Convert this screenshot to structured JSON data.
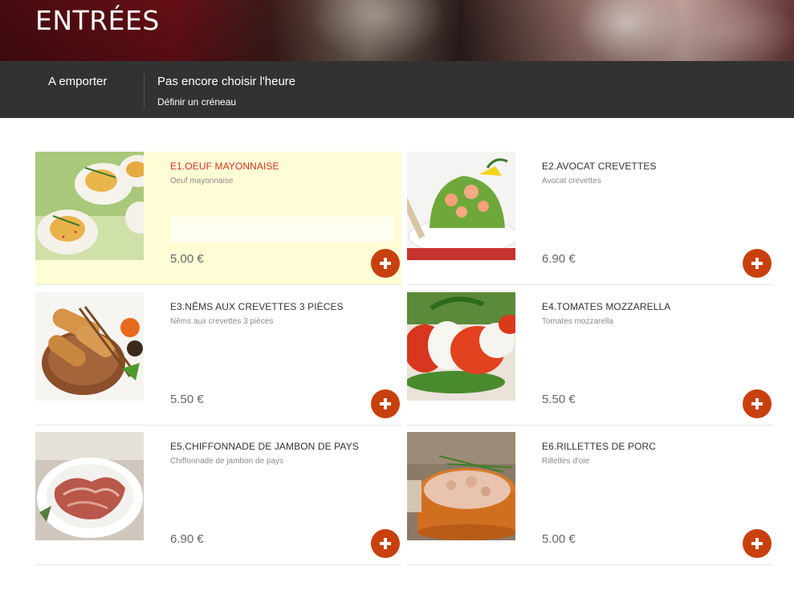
{
  "page": {
    "title": "ENTRÉES"
  },
  "order_bar": {
    "mode_label": "A emporter",
    "time_title": "Pas encore choisir l'heure",
    "time_link": "Définir un créneau"
  },
  "items": [
    {
      "name": "E1.OEUF MAYONNAISE",
      "description": "Oeuf mayonnaise",
      "price": "5.00 €",
      "image": "eggs-mayonnaise-image",
      "highlighted": true
    },
    {
      "name": "E2.AVOCAT CREVETTES",
      "description": "Avocat crevettes",
      "price": "6.90 €",
      "image": "avocado-shrimp-image",
      "highlighted": false
    },
    {
      "name": "E3.NÊMS AUX CREVETTES 3 PIÈCES",
      "description": "Nêms aux crevettes 3 pièces",
      "price": "5.50 €",
      "image": "spring-rolls-image",
      "highlighted": false
    },
    {
      "name": "E4.TOMATES MOZZARELLA",
      "description": "Tomates mozzarella",
      "price": "5.50 €",
      "image": "tomato-mozzarella-image",
      "highlighted": false
    },
    {
      "name": "E5.CHIFFONNADE DE JAMBON DE PAYS",
      "description": "Chiffonnade de jambon de pays",
      "price": "6.90 €",
      "image": "ham-chiffonnade-image",
      "highlighted": false
    },
    {
      "name": "E6.RILLETTES DE PORC",
      "description": "Rillettes d'oie",
      "price": "5.00 €",
      "image": "rillettes-image",
      "highlighted": false
    }
  ],
  "icons": {
    "add": "plus-icon"
  },
  "colors": {
    "accent": "#c8400e",
    "highlight_bg": "#fffdd6",
    "bar_bg": "#323232",
    "highlight_name": "#d0341f"
  }
}
